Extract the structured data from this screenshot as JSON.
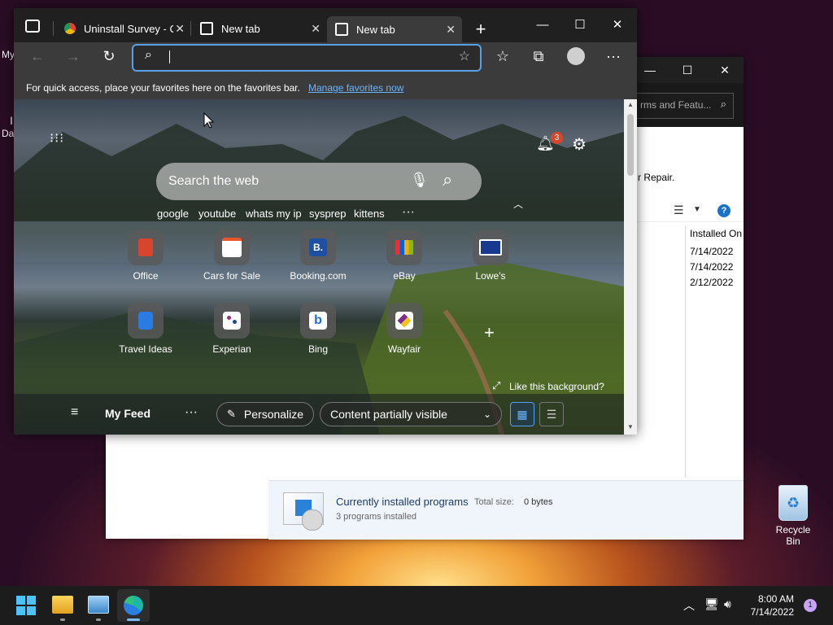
{
  "desktop": {
    "left_text_1": "My",
    "left_text_2": "I",
    "left_text_3": "Da",
    "recycle_bin_label": "Recycle Bin"
  },
  "control_panel": {
    "search_placeholder": "rms and Featu...",
    "repair_text": "r Repair.",
    "column_header": "Installed On",
    "dates": [
      "7/14/2022",
      "7/14/2022",
      "2/12/2022"
    ],
    "status_title": "Currently installed programs",
    "status_total_label": "Total size:",
    "status_total_value": "0 bytes",
    "status_count": "3 programs installed"
  },
  "browser": {
    "tabs": [
      {
        "title": "Uninstall Survey - C"
      },
      {
        "title": "New tab"
      },
      {
        "title": "New tab"
      }
    ],
    "favorites_bar_text": "For quick access, place your favorites here on the favorites bar.",
    "favorites_bar_link": "Manage favorites now",
    "address_value": "",
    "ntp": {
      "search_placeholder": "Search the web",
      "notification_count": "3",
      "quick_searches": [
        "google",
        "youtube",
        "whats my ip",
        "sysprep",
        "kittens"
      ],
      "tiles_row1": [
        {
          "label": "Office",
          "icon": "office-icon",
          "color": "#d8452e"
        },
        {
          "label": "Cars for Sale",
          "icon": "car-icon",
          "color": "#e8562a"
        },
        {
          "label": "Booking.com",
          "icon": "booking-icon",
          "color": "#1f4fa3"
        },
        {
          "label": "eBay",
          "icon": "ebay-icon",
          "color": "#e53238"
        },
        {
          "label": "Lowe's",
          "icon": "lowes-icon",
          "color": "#173a8f"
        }
      ],
      "tiles_row2": [
        {
          "label": "Travel Ideas",
          "icon": "travel-icon",
          "color": "#2b7be4"
        },
        {
          "label": "Experian",
          "icon": "experian-icon",
          "color": "#a02b79"
        },
        {
          "label": "Bing",
          "icon": "bing-icon",
          "color": "#1e6fd9"
        },
        {
          "label": "Wayfair",
          "icon": "wayfair-icon",
          "color": "#7b2c8f"
        }
      ],
      "background_prompt": "Like this background?",
      "feed_title": "My Feed",
      "personalize_label": "Personalize",
      "content_dropdown": "Content partially visible"
    }
  },
  "taskbar": {
    "time": "8:00 AM",
    "date": "7/14/2022",
    "notification_badge": "1"
  }
}
